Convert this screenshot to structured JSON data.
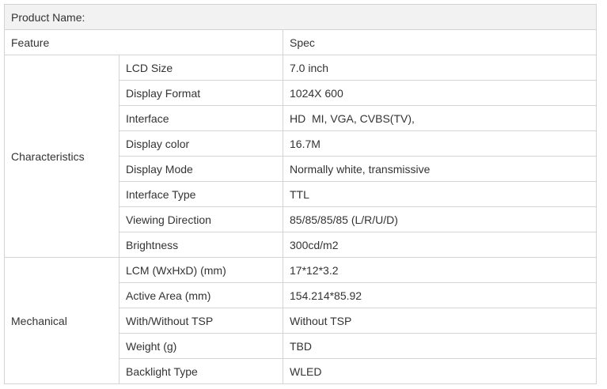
{
  "title": "Product Name:",
  "header": {
    "feature": "Feature",
    "spec": "Spec"
  },
  "groups": [
    {
      "name": "Characteristics",
      "rows": [
        {
          "label": "LCD Size",
          "value": "7.0 inch"
        },
        {
          "label": "Display Format",
          "value": "1024X 600"
        },
        {
          "label": "Interface",
          "value": "HD  MI, VGA, CVBS(TV),"
        },
        {
          "label": "Display color",
          "value": "16.7M"
        },
        {
          "label": "Display Mode",
          "value": "Normally white, transmissive"
        },
        {
          "label": "Interface Type",
          "value": "TTL"
        },
        {
          "label": "Viewing Direction",
          "value": "85/85/85/85 (L/R/U/D)"
        },
        {
          "label": "Brightness",
          "value": "300cd/m2"
        }
      ]
    },
    {
      "name": "Mechanical",
      "rows": [
        {
          "label": "LCM (WxHxD) (mm)",
          "value": "17*12*3.2"
        },
        {
          "label": "Active Area (mm)",
          "value": "154.214*85.92"
        },
        {
          "label": "With/Without TSP",
          "value": "Without TSP"
        },
        {
          "label": "Weight (g)",
          "value": "TBD"
        },
        {
          "label": "Backlight Type",
          "value": "WLED"
        }
      ]
    }
  ]
}
